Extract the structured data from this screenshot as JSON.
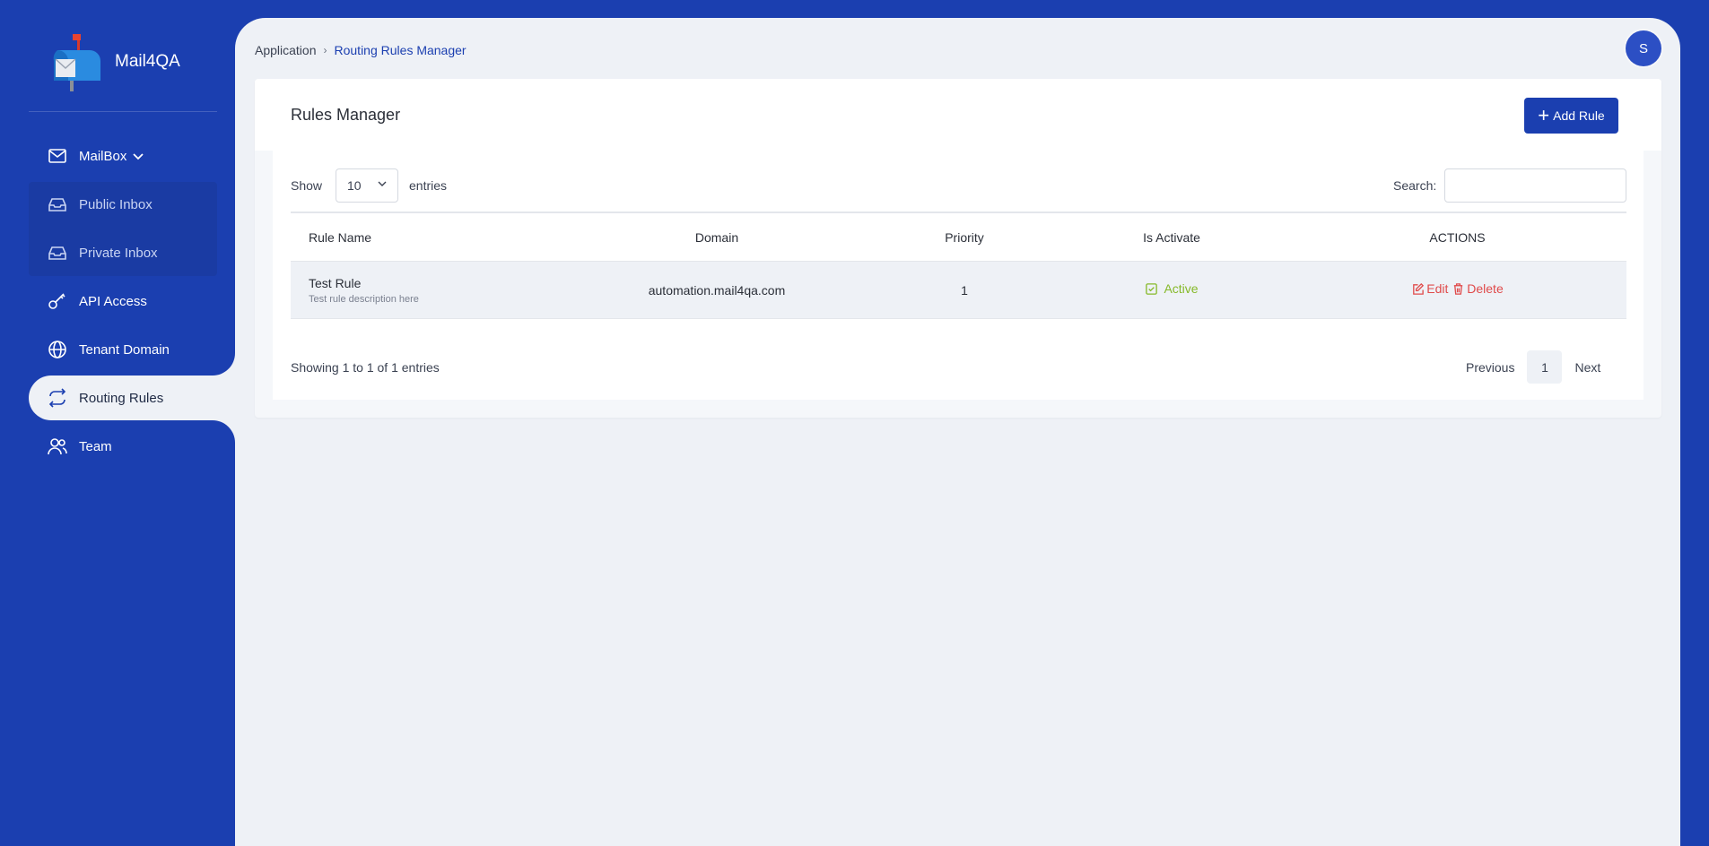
{
  "brand": {
    "name": "Mail4QA"
  },
  "sidebar": {
    "mailbox_label": "MailBox",
    "items": [
      {
        "label": "Public Inbox"
      },
      {
        "label": "Private Inbox"
      },
      {
        "label": "API Access"
      },
      {
        "label": "Tenant Domain"
      },
      {
        "label": "Routing Rules"
      },
      {
        "label": "Team"
      }
    ]
  },
  "breadcrumb": {
    "root": "Application",
    "current": "Routing Rules Manager"
  },
  "user": {
    "initial": "S"
  },
  "page": {
    "title": "Rules Manager",
    "add_button": "Add Rule"
  },
  "table_controls": {
    "show_label": "Show",
    "page_size": "10",
    "entries_label": "entries",
    "search_label": "Search:",
    "search_value": ""
  },
  "table": {
    "headers": [
      "Rule Name",
      "Domain",
      "Priority",
      "Is Activate",
      "ACTIONS"
    ],
    "rows": [
      {
        "name": "Test Rule",
        "description": "Test rule description here",
        "domain": "automation.mail4qa.com",
        "priority": "1",
        "status": "Active",
        "edit_label": "Edit",
        "delete_label": "Delete"
      }
    ]
  },
  "footer": {
    "info": "Showing 1 to 1 of 1 entries",
    "previous": "Previous",
    "current_page": "1",
    "next": "Next"
  },
  "colors": {
    "brand_blue": "#1b3fb0",
    "background": "#eef1f6",
    "active_green": "#86b929",
    "danger_red": "#e04b4b"
  }
}
